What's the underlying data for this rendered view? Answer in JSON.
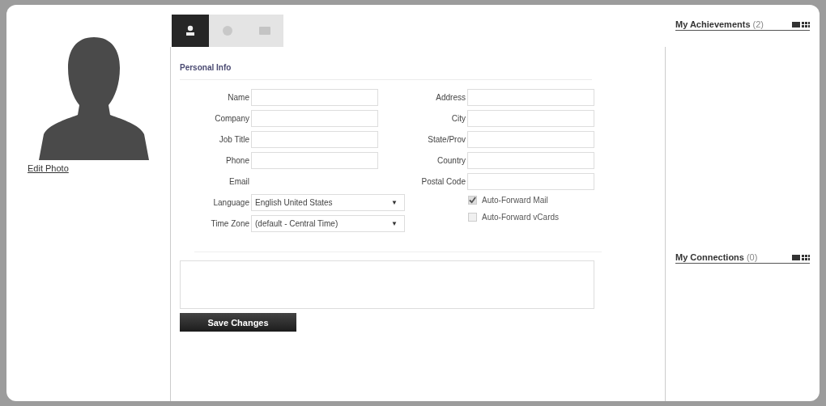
{
  "photo": {
    "link": "Edit Photo"
  },
  "tabs": [
    {
      "kind": "person",
      "selected": true
    },
    {
      "kind": "globe",
      "selected": false
    },
    {
      "kind": "card",
      "selected": false
    }
  ],
  "section_title": "Personal Info",
  "left_fields": [
    {
      "label": "Name",
      "kind": "input"
    },
    {
      "label": "Company",
      "kind": "input"
    },
    {
      "label": "Job Title",
      "kind": "input"
    },
    {
      "label": "Phone",
      "kind": "input"
    },
    {
      "label": "Email",
      "kind": "text"
    },
    {
      "label": "Language",
      "kind": "select",
      "value": "English United States",
      "caret": "▼"
    },
    {
      "label": "Time Zone",
      "kind": "select",
      "value": "(default - Central Time)",
      "caret": "▼"
    }
  ],
  "right_fields": [
    {
      "label": "Address",
      "kind": "input"
    },
    {
      "label": "City",
      "kind": "input"
    },
    {
      "label": "State/Prov",
      "kind": "input"
    },
    {
      "label": "Country",
      "kind": "input"
    },
    {
      "label": "Postal Code",
      "kind": "input"
    }
  ],
  "checkboxes": [
    {
      "label": "Auto-Forward Mail",
      "checked": true
    },
    {
      "label": "Auto-Forward vCards",
      "checked": false
    }
  ],
  "save_button": "Save Changes",
  "sidebar": [
    {
      "title": "My Achievements",
      "count": "(2)"
    },
    {
      "title": "My Connections",
      "count": "(0)"
    }
  ]
}
